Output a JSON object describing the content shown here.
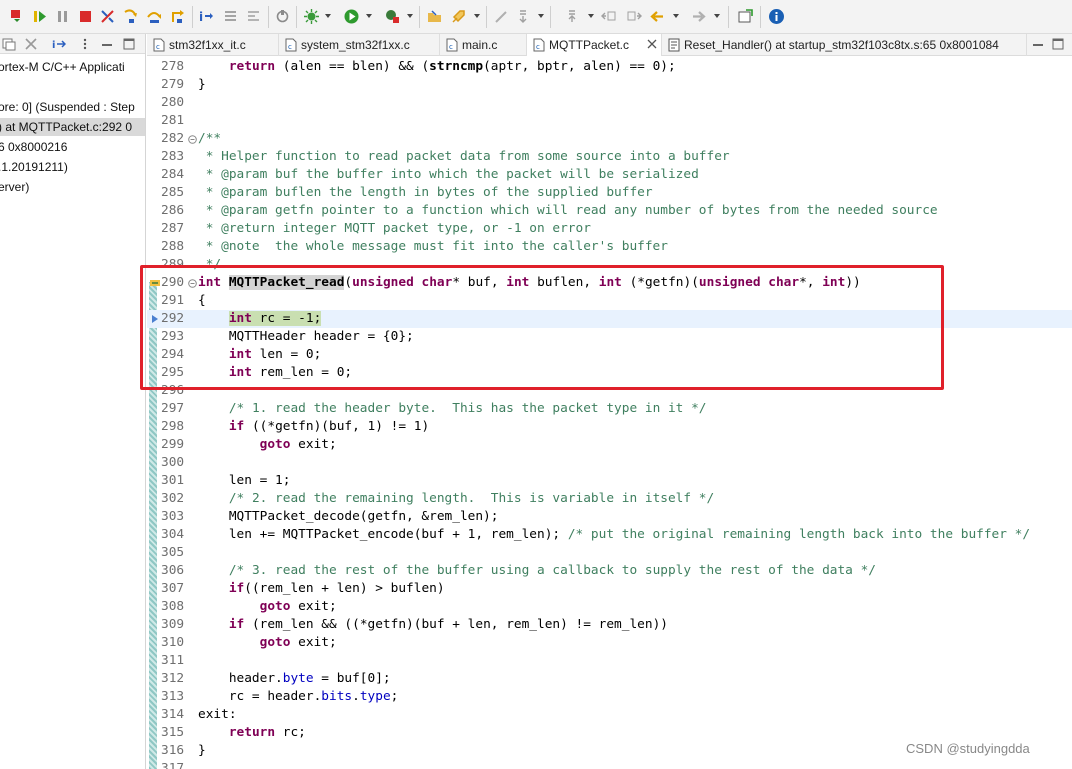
{
  "left_pane": {
    "lines": [
      "ortex-M C/C++ Applicati",
      "ore: 0] (Suspended : Step",
      ") at MQTTPacket.c:292 0",
      "6 0x8000216",
      ".1.20191211)",
      "erver)"
    ]
  },
  "tabs": [
    {
      "label": "stm32f1xx_it.c"
    },
    {
      "label": "system_stm32f1xx.c"
    },
    {
      "label": "main.c"
    },
    {
      "label": "MQTTPacket.c"
    },
    {
      "label": "Reset_Handler() at startup_stm32f103c8tx.s:65 0x8001084"
    }
  ],
  "editor": {
    "active_line": "292",
    "lines": [
      {
        "n": "278",
        "t": [
          [
            "",
            "    "
          ],
          [
            "kw",
            "return"
          ],
          [
            "",
            " (alen == blen) && ("
          ],
          [
            "fn",
            "strncmp"
          ],
          [
            "",
            "(aptr, bptr, alen) == 0);"
          ]
        ]
      },
      {
        "n": "279",
        "t": [
          [
            "",
            "}"
          ]
        ]
      },
      {
        "n": "280",
        "t": []
      },
      {
        "n": "281",
        "t": []
      },
      {
        "n": "282",
        "fold": true,
        "t": [
          [
            "cm",
            "/**"
          ]
        ]
      },
      {
        "n": "283",
        "t": [
          [
            "cm",
            " * Helper function to read packet data from some source into a buffer"
          ]
        ]
      },
      {
        "n": "284",
        "t": [
          [
            "cm",
            " * @param buf the buffer into which the packet will be serialized"
          ]
        ]
      },
      {
        "n": "285",
        "t": [
          [
            "cm",
            " * @param buflen the length in bytes of the supplied buffer"
          ]
        ]
      },
      {
        "n": "286",
        "t": [
          [
            "cm",
            " * @param getfn pointer to a function which will read any number of bytes from the needed source"
          ]
        ]
      },
      {
        "n": "287",
        "t": [
          [
            "cm",
            " * @return integer MQTT packet type, or -1 on error"
          ]
        ]
      },
      {
        "n": "288",
        "t": [
          [
            "cm",
            " * @note  the whole message must fit into the caller's buffer"
          ]
        ]
      },
      {
        "n": "289",
        "t": [
          [
            "cm",
            " */"
          ]
        ]
      },
      {
        "n": "290",
        "fold": true,
        "marker": "arrow",
        "t": [
          [
            "kw",
            "int"
          ],
          [
            "",
            " "
          ],
          [
            "fnhl",
            "MQTTPacket_read"
          ],
          [
            "",
            "("
          ],
          [
            "kw",
            "unsigned"
          ],
          [
            "",
            " "
          ],
          [
            "kw",
            "char"
          ],
          [
            "",
            "* buf, "
          ],
          [
            "kw",
            "int"
          ],
          [
            "",
            " buflen, "
          ],
          [
            "kw",
            "int"
          ],
          [
            "",
            " (*getfn)("
          ],
          [
            "kw",
            "unsigned"
          ],
          [
            "",
            " "
          ],
          [
            "kw",
            "char"
          ],
          [
            "",
            "*, "
          ],
          [
            "kw",
            "int"
          ],
          [
            "",
            "))"
          ]
        ]
      },
      {
        "n": "291",
        "t": [
          [
            "",
            "{"
          ]
        ]
      },
      {
        "n": "292",
        "current": true,
        "marker": "pc",
        "t": [
          [
            "",
            "    "
          ],
          [
            "kwhl",
            "int"
          ],
          [
            "pc",
            " rc = -1;"
          ]
        ]
      },
      {
        "n": "293",
        "t": [
          [
            "",
            "    MQTTHeader header = {0};"
          ]
        ]
      },
      {
        "n": "294",
        "t": [
          [
            "",
            "    "
          ],
          [
            "kw",
            "int"
          ],
          [
            "",
            " len = 0;"
          ]
        ]
      },
      {
        "n": "295",
        "t": [
          [
            "",
            "    "
          ],
          [
            "kw",
            "int"
          ],
          [
            "",
            " rem_len = 0;"
          ]
        ]
      },
      {
        "n": "296",
        "t": []
      },
      {
        "n": "297",
        "t": [
          [
            "",
            "    "
          ],
          [
            "cm",
            "/* 1. read the header byte.  This has the packet type in it */"
          ]
        ]
      },
      {
        "n": "298",
        "t": [
          [
            "",
            "    "
          ],
          [
            "kw",
            "if"
          ],
          [
            "",
            " ((*getfn)(buf, 1) != 1)"
          ]
        ]
      },
      {
        "n": "299",
        "t": [
          [
            "",
            "        "
          ],
          [
            "kw",
            "goto"
          ],
          [
            "",
            " exit;"
          ]
        ]
      },
      {
        "n": "300",
        "t": []
      },
      {
        "n": "301",
        "t": [
          [
            "",
            "    len = 1;"
          ]
        ]
      },
      {
        "n": "302",
        "t": [
          [
            "",
            "    "
          ],
          [
            "cm",
            "/* 2. read the remaining length.  This is variable in itself */"
          ]
        ]
      },
      {
        "n": "303",
        "t": [
          [
            "",
            "    MQTTPacket_decode(getfn, &rem_len);"
          ]
        ]
      },
      {
        "n": "304",
        "t": [
          [
            "",
            "    len += MQTTPacket_encode(buf + 1, rem_len); "
          ],
          [
            "cm",
            "/* put the original remaining length back into the buffer */"
          ]
        ]
      },
      {
        "n": "305",
        "t": []
      },
      {
        "n": "306",
        "t": [
          [
            "",
            "    "
          ],
          [
            "cm",
            "/* 3. read the rest of the buffer using a callback to supply the rest of the data */"
          ]
        ]
      },
      {
        "n": "307",
        "t": [
          [
            "",
            "    "
          ],
          [
            "kw",
            "if"
          ],
          [
            "",
            "((rem_len + len) > buflen)"
          ]
        ]
      },
      {
        "n": "308",
        "t": [
          [
            "",
            "        "
          ],
          [
            "kw",
            "goto"
          ],
          [
            "",
            " exit;"
          ]
        ]
      },
      {
        "n": "309",
        "t": [
          [
            "",
            "    "
          ],
          [
            "kw",
            "if"
          ],
          [
            "",
            " (rem_len && ((*getfn)(buf + len, rem_len) != rem_len))"
          ]
        ]
      },
      {
        "n": "310",
        "t": [
          [
            "",
            "        "
          ],
          [
            "kw",
            "goto"
          ],
          [
            "",
            " exit;"
          ]
        ]
      },
      {
        "n": "311",
        "t": []
      },
      {
        "n": "312",
        "t": [
          [
            "",
            "    header."
          ],
          [
            "fld",
            "byte"
          ],
          [
            "",
            " = buf[0];"
          ]
        ]
      },
      {
        "n": "313",
        "t": [
          [
            "",
            "    rc = header."
          ],
          [
            "fld",
            "bits"
          ],
          [
            "",
            "."
          ],
          [
            "fld",
            "type"
          ],
          [
            "",
            ";"
          ]
        ]
      },
      {
        "n": "314",
        "t": [
          [
            "",
            "exit:"
          ]
        ]
      },
      {
        "n": "315",
        "t": [
          [
            "",
            "    "
          ],
          [
            "kw",
            "return"
          ],
          [
            "",
            " rc;"
          ]
        ]
      },
      {
        "n": "316",
        "t": [
          [
            "",
            "}"
          ]
        ]
      },
      {
        "n": "317",
        "t": []
      }
    ]
  },
  "watermark": "CSDN @studyingdda",
  "colors": {
    "keyword": "#7f0055",
    "comment": "#3f7f5f",
    "field": "#0000c0",
    "highlight_box": "#e0202a",
    "current_line": "#e8f2fe",
    "pc_highlight": "#c9dfb1"
  },
  "icons": {
    "toolbar": [
      "debug-icon",
      "resume-icon",
      "suspend-icon",
      "terminate-icon",
      "disconnect-icon",
      "step-into-icon",
      "step-over-icon",
      "step-return-icon",
      "instruction-stepping-icon",
      "debug-config-icon",
      "run-icon",
      "external-tools-icon",
      "open-type-icon",
      "bug-icon",
      "forward-icon",
      "info-icon"
    ]
  }
}
